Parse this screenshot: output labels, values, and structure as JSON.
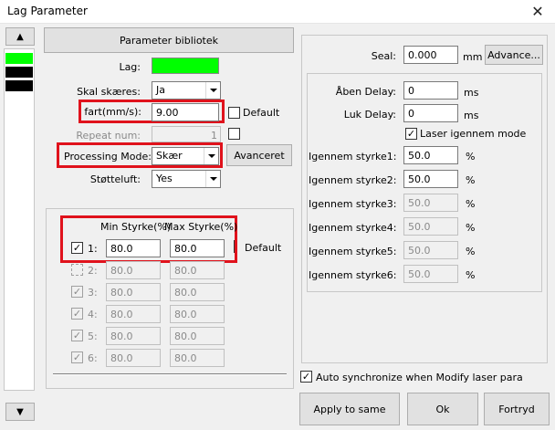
{
  "window": {
    "title": "Lag Parameter",
    "close_glyph": "✕"
  },
  "layer_list": {
    "colors": [
      "#00ff00",
      "#000000",
      "#000000"
    ],
    "scroll_up": "▲",
    "scroll_down": "▼"
  },
  "left": {
    "library_button": "Parameter bibliotek",
    "layer_label": "Lag:",
    "layer_color": "#00ff00",
    "cut_label": "Skal skæres:",
    "cut_value": "Ja",
    "speed_label": "fart(mm/s):",
    "speed_value": "9.00",
    "default_label": "Default",
    "repeat_label": "Repeat num:",
    "repeat_value": "1",
    "mode_label": "Processing Mode:",
    "mode_value": "Skær",
    "advanced_button": "Avanceret",
    "air_label": "Støtteluft:",
    "air_value": "Yes"
  },
  "power": {
    "min_header": "Min Styrke(%)",
    "max_header": "Max Styrke(%)",
    "default_label": "Default",
    "rows": [
      {
        "label": "1:",
        "checked": true,
        "min": "80.0",
        "max": "80.0",
        "enabled": true
      },
      {
        "label": "2:",
        "checked": false,
        "min": "80.0",
        "max": "80.0",
        "enabled": false
      },
      {
        "label": "3:",
        "checked": true,
        "min": "80.0",
        "max": "80.0",
        "enabled": false
      },
      {
        "label": "4:",
        "checked": true,
        "min": "80.0",
        "max": "80.0",
        "enabled": false
      },
      {
        "label": "5:",
        "checked": true,
        "min": "80.0",
        "max": "80.0",
        "enabled": false
      },
      {
        "label": "6:",
        "checked": true,
        "min": "80.0",
        "max": "80.0",
        "enabled": false
      }
    ]
  },
  "right": {
    "seal_label": "Seal:",
    "seal_value": "0.000",
    "seal_unit": "mm",
    "advance_button": "Advance...",
    "open_delay_label": "Åben Delay:",
    "open_delay_value": "0",
    "open_delay_unit": "ms",
    "close_delay_label": "Luk Delay:",
    "close_delay_value": "0",
    "close_delay_unit": "ms",
    "laser_through_label": "Laser igennem mode",
    "through_rows": [
      {
        "label": "Igennem styrke1:",
        "value": "50.0",
        "unit": "%",
        "enabled": true
      },
      {
        "label": "Igennem styrke2:",
        "value": "50.0",
        "unit": "%",
        "enabled": true
      },
      {
        "label": "Igennem styrke3:",
        "value": "50.0",
        "unit": "%",
        "enabled": false
      },
      {
        "label": "Igennem styrke4:",
        "value": "50.0",
        "unit": "%",
        "enabled": false
      },
      {
        "label": "Igennem styrke5:",
        "value": "50.0",
        "unit": "%",
        "enabled": false
      },
      {
        "label": "Igennem styrke6:",
        "value": "50.0",
        "unit": "%",
        "enabled": false
      }
    ]
  },
  "footer": {
    "auto_sync_label": "Auto synchronize when Modify laser para",
    "apply_button": "Apply to same",
    "ok_button": "Ok",
    "cancel_button": "Fortryd"
  },
  "check_glyph": "✓"
}
